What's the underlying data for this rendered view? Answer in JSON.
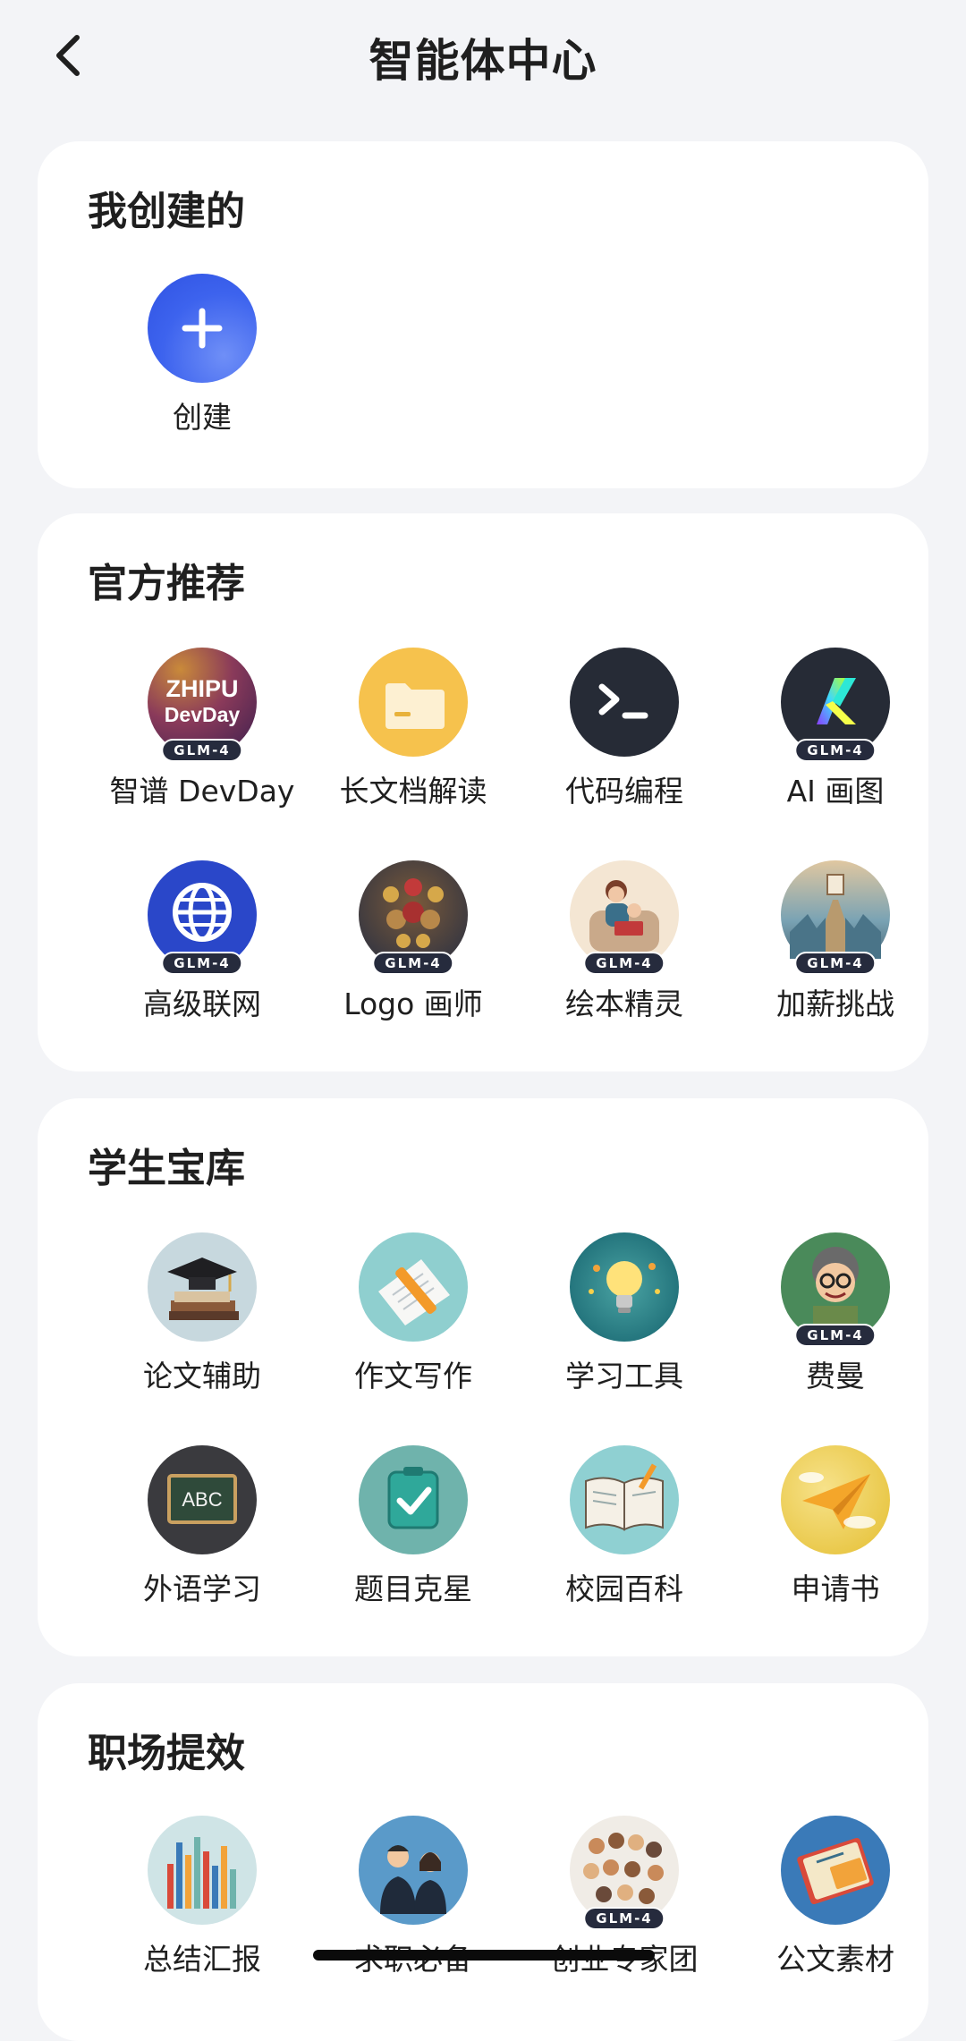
{
  "header": {
    "title": "智能体中心"
  },
  "sections": {
    "mine": {
      "title": "我创建的",
      "create_label": "创建"
    },
    "official": {
      "title": "官方推荐",
      "items": [
        {
          "label": "智谱 DevDay",
          "badge": "GLM-4",
          "icon": "zhipu-devday-logo-icon"
        },
        {
          "label": "长文档解读",
          "icon": "folder-icon"
        },
        {
          "label": "代码编程",
          "icon": "terminal-icon"
        },
        {
          "label": "AI 画图",
          "badge": "GLM-4",
          "icon": "ai-draw-logo-icon"
        },
        {
          "label": "高级联网",
          "badge": "GLM-4",
          "icon": "globe-icon"
        },
        {
          "label": "Logo 画师",
          "badge": "GLM-4",
          "icon": "logo-art-icon"
        },
        {
          "label": "绘本精灵",
          "badge": "GLM-4",
          "icon": "storybook-icon"
        },
        {
          "label": "加薪挑战",
          "badge": "GLM-4",
          "icon": "salary-challenge-icon"
        }
      ],
      "logo_text": {
        "line1": "ZHIPU",
        "line2": "DevDay"
      }
    },
    "student": {
      "title": "学生宝库",
      "items": [
        {
          "label": "论文辅助",
          "icon": "graduation-books-icon"
        },
        {
          "label": "作文写作",
          "icon": "pen-paper-icon"
        },
        {
          "label": "学习工具",
          "icon": "lightbulb-icon"
        },
        {
          "label": "费曼",
          "badge": "GLM-4",
          "icon": "feynman-portrait-icon"
        },
        {
          "label": "外语学习",
          "icon": "chalkboard-icon"
        },
        {
          "label": "题目克星",
          "icon": "check-clipboard-icon"
        },
        {
          "label": "校园百科",
          "icon": "open-book-icon"
        },
        {
          "label": "申请书",
          "icon": "paper-plane-icon"
        }
      ],
      "chalkboard_text": "ABC"
    },
    "work": {
      "title": "职场提效",
      "items": [
        {
          "label": "总结汇报",
          "icon": "bar-report-icon"
        },
        {
          "label": "求职必备",
          "icon": "job-seekers-icon"
        },
        {
          "label": "创业专家团",
          "badge": "GLM-4",
          "icon": "startup-team-icon"
        },
        {
          "label": "公文素材",
          "icon": "document-notebook-icon"
        }
      ]
    }
  },
  "colors": {
    "background": "#f3f4f7",
    "card": "#ffffff",
    "accent_blue": "#3d6cf0",
    "badge": "#262b3d"
  }
}
